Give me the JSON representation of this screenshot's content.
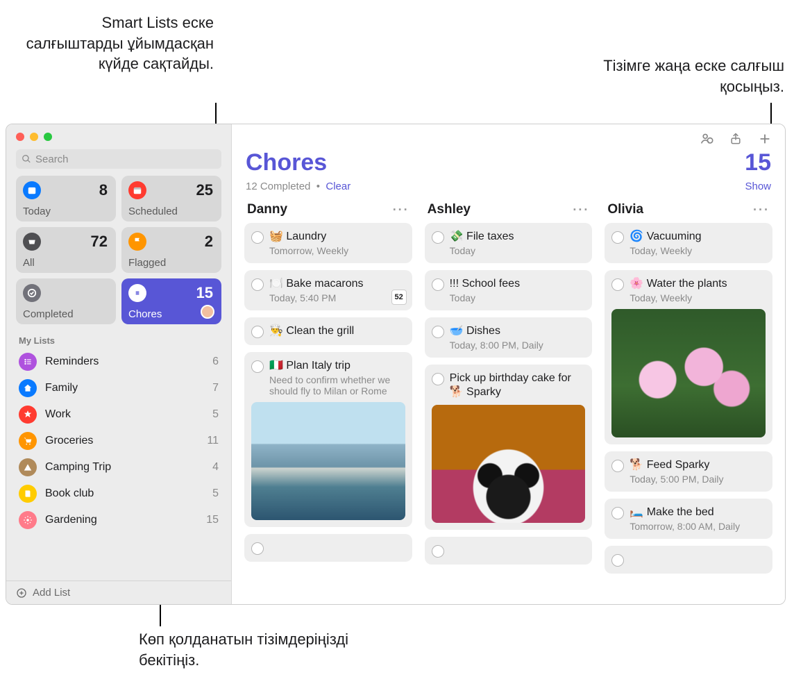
{
  "callouts": {
    "smart": "Smart Lists еске салғыштарды ұйымдасқан күйде сақтайды.",
    "add": "Тізімге жаңа еске салғыш қосыңыз.",
    "pin": "Көп қолданатын тізімдеріңізді бекітіңіз."
  },
  "sidebar": {
    "search_placeholder": "Search",
    "smart": [
      {
        "name": "Today",
        "count": "8",
        "color": "#0a7aff"
      },
      {
        "name": "Scheduled",
        "count": "25",
        "color": "#ff3b30"
      },
      {
        "name": "All",
        "count": "72",
        "color": "#4f4f52"
      },
      {
        "name": "Flagged",
        "count": "2",
        "color": "#ff9500"
      },
      {
        "name": "Completed",
        "count": "",
        "color": "#72727a"
      },
      {
        "name": "Chores",
        "count": "15",
        "color": "#5856d6",
        "active": true,
        "avatar": true
      }
    ],
    "section_label": "My Lists",
    "lists": [
      {
        "name": "Reminders",
        "count": "6",
        "color": "#af52de"
      },
      {
        "name": "Family",
        "count": "7",
        "color": "#0a7aff"
      },
      {
        "name": "Work",
        "count": "5",
        "color": "#ff3b30"
      },
      {
        "name": "Groceries",
        "count": "11",
        "color": "#ff9500"
      },
      {
        "name": "Camping Trip",
        "count": "4",
        "color": "#b08a5a"
      },
      {
        "name": "Book club",
        "count": "5",
        "color": "#ffcc00"
      },
      {
        "name": "Gardening",
        "count": "15",
        "color": "#ff7b8a"
      }
    ],
    "add_list": "Add List"
  },
  "main": {
    "title": "Chores",
    "count": "15",
    "completed_text": "12 Completed",
    "dot": "•",
    "clear": "Clear",
    "show": "Show",
    "columns": [
      {
        "name": "Danny",
        "items": [
          {
            "title": "🧺 Laundry",
            "sub": "Tomorrow, Weekly"
          },
          {
            "title": "🍽️ Bake macarons",
            "sub": "Today, 5:40 PM",
            "badge": "52"
          },
          {
            "title": "👨‍🍳 Clean the grill"
          },
          {
            "title": "🇮🇹 Plan Italy trip",
            "sub": "Need to confirm whether we should fly to Milan or Rome",
            "image": "italy"
          }
        ],
        "trailing_empty": true
      },
      {
        "name": "Ashley",
        "items": [
          {
            "title": "💸 File taxes",
            "sub": "Today"
          },
          {
            "title": "!!! School fees",
            "sub": "Today"
          },
          {
            "title": "🥣 Dishes",
            "sub": "Today, 8:00 PM, Daily"
          },
          {
            "title": "Pick up birthday cake for 🐕 Sparky",
            "image": "dog"
          }
        ],
        "trailing_empty": true
      },
      {
        "name": "Olivia",
        "items": [
          {
            "title": "🌀 Vacuuming",
            "sub": "Today, Weekly"
          },
          {
            "title": "🌸 Water the plants",
            "sub": "Today, Weekly",
            "image": "flowers"
          },
          {
            "title": "🐕 Feed Sparky",
            "sub": "Today, 5:00 PM, Daily"
          },
          {
            "title": "🛏️ Make the bed",
            "sub": "Tomorrow, 8:00 AM, Daily"
          }
        ],
        "trailing_empty": true
      }
    ]
  }
}
